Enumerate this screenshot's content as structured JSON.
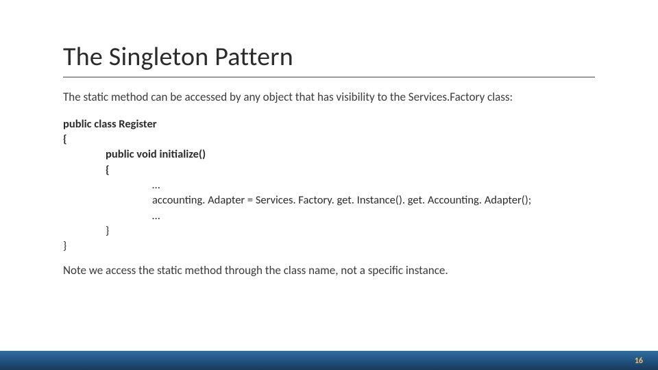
{
  "title": "The Singleton Pattern",
  "intro": "The static method can be accessed by any object that has visibility to the Services.Factory class:",
  "code": {
    "l1": "public class Register",
    "l2": "{",
    "l3": "public void initialize()",
    "l4": "{",
    "l5": "…",
    "l6": "accounting. Adapter = Services. Factory. get. Instance(). get. Accounting. Adapter();",
    "l7": "…",
    "l8": "}",
    "l9": "}"
  },
  "note": "Note we access the static method through the class name, not a specific instance.",
  "page_number": "16"
}
